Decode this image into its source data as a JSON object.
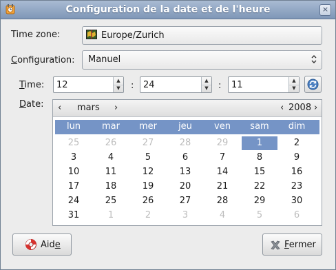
{
  "window": {
    "title": "Configuration de la date et de l'heure",
    "close_glyph": "×"
  },
  "timezone": {
    "label": "Time zone:",
    "value": "Europe/Zurich"
  },
  "configuration": {
    "label_first": "C",
    "label_rest": "onfiguration:",
    "value": "Manuel"
  },
  "time": {
    "label_first": "T",
    "label_rest": "ime:",
    "hours": "12",
    "minutes": "24",
    "seconds": "11",
    "separator": ":"
  },
  "date": {
    "label_first": "D",
    "label_rest": "ate:",
    "month": "mars",
    "year": "2008",
    "prev_glyph": "‹",
    "next_glyph": "›"
  },
  "calendar": {
    "weekdays": [
      "lun",
      "mar",
      "mer",
      "jeu",
      "ven",
      "sam",
      "dim"
    ],
    "weeks": [
      [
        "25",
        "26",
        "27",
        "28",
        "29",
        "1",
        "2"
      ],
      [
        "3",
        "4",
        "5",
        "6",
        "7",
        "8",
        "9"
      ],
      [
        "10",
        "11",
        "12",
        "13",
        "14",
        "15",
        "16"
      ],
      [
        "17",
        "18",
        "19",
        "20",
        "21",
        "22",
        "23"
      ],
      [
        "24",
        "25",
        "26",
        "27",
        "28",
        "29",
        "30"
      ],
      [
        "31",
        "1",
        "2",
        "3",
        "4",
        "5",
        "6"
      ]
    ],
    "selected_day": "1",
    "selected_color": "#7594c6"
  },
  "buttons": {
    "help_prefix": "Aid",
    "help_mnemonic": "e",
    "close_mnemonic": "F",
    "close_rest": "ermer"
  },
  "colors": {
    "header_blue": "#7594c6",
    "titlebar": "#8ea3c2"
  }
}
